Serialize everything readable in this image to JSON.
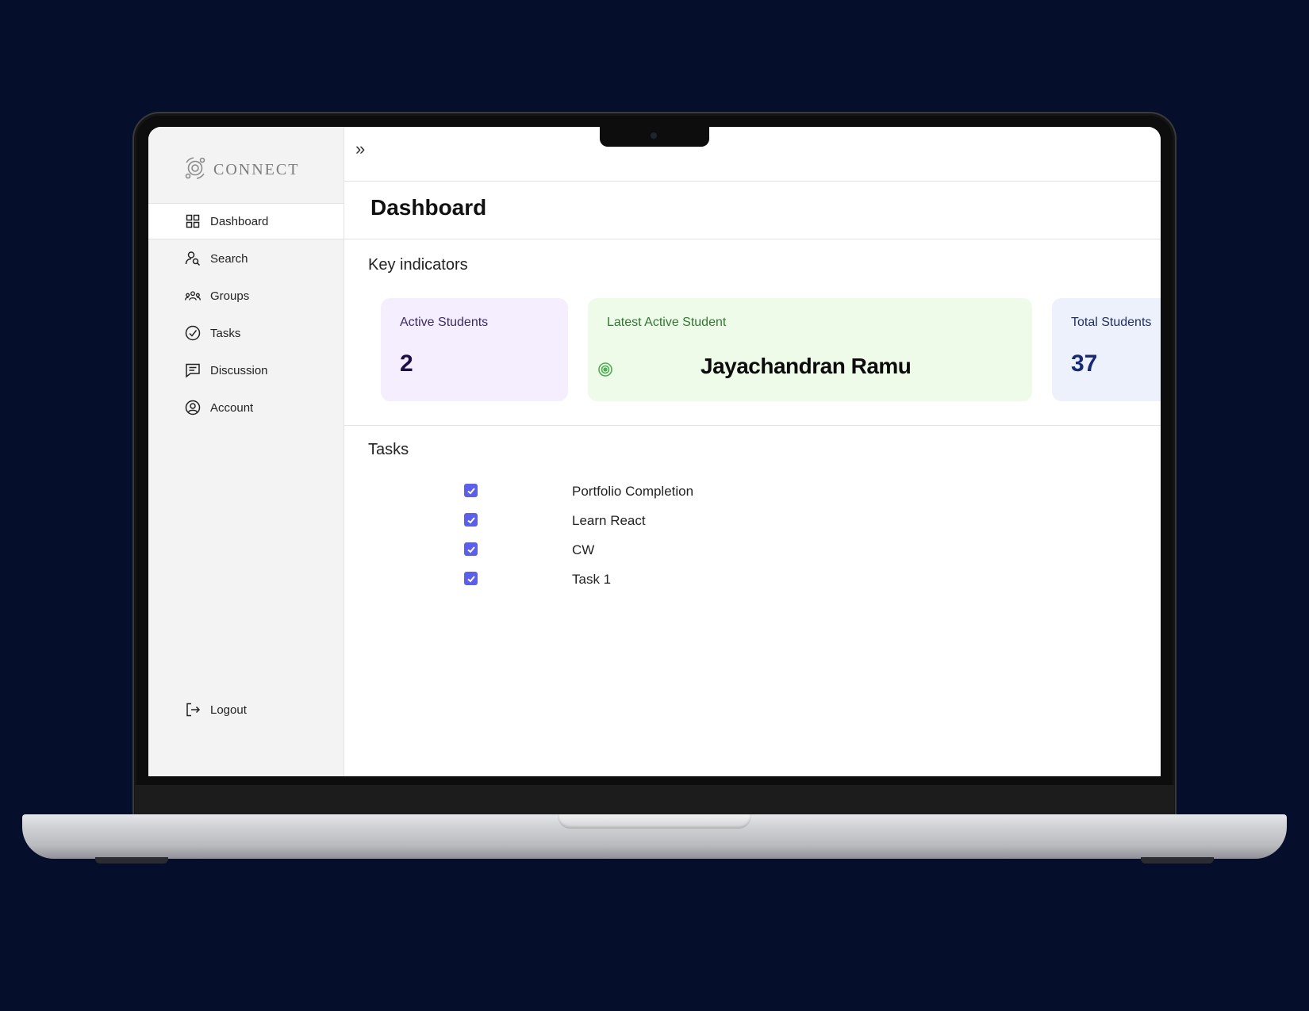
{
  "app": {
    "logo_text": "CONNECT"
  },
  "sidebar": {
    "items": [
      {
        "label": "Dashboard",
        "icon": "grid-icon",
        "active": true
      },
      {
        "label": "Search",
        "icon": "user-search-icon"
      },
      {
        "label": "Groups",
        "icon": "users-group-icon"
      },
      {
        "label": "Tasks",
        "icon": "check-circle-icon"
      },
      {
        "label": "Discussion",
        "icon": "message-square-icon"
      },
      {
        "label": "Account",
        "icon": "user-circle-icon"
      }
    ],
    "logout_label": "Logout"
  },
  "topbar": {
    "expand_glyph": "»"
  },
  "page": {
    "title": "Dashboard"
  },
  "kpi": {
    "section_title": "Key indicators",
    "active_students": {
      "label": "Active Students",
      "value": "2"
    },
    "latest_active_student": {
      "label": "Latest Active Student",
      "name": "Jayachandran Ramu"
    },
    "total_students": {
      "label": "Total Students",
      "value": "37"
    }
  },
  "tasks": {
    "section_title": "Tasks",
    "items": [
      {
        "label": "Portfolio Completion",
        "checked": true
      },
      {
        "label": "Learn React",
        "checked": true
      },
      {
        "label": "CW",
        "checked": true
      },
      {
        "label": "Task 1",
        "checked": true
      }
    ]
  },
  "colors": {
    "background": "#050f2b",
    "accent": "#5b5ff0",
    "card_purple": "#f5eeff",
    "card_green": "#effbe9",
    "card_blue": "#edf1fb",
    "status_green": "#4caf50"
  }
}
